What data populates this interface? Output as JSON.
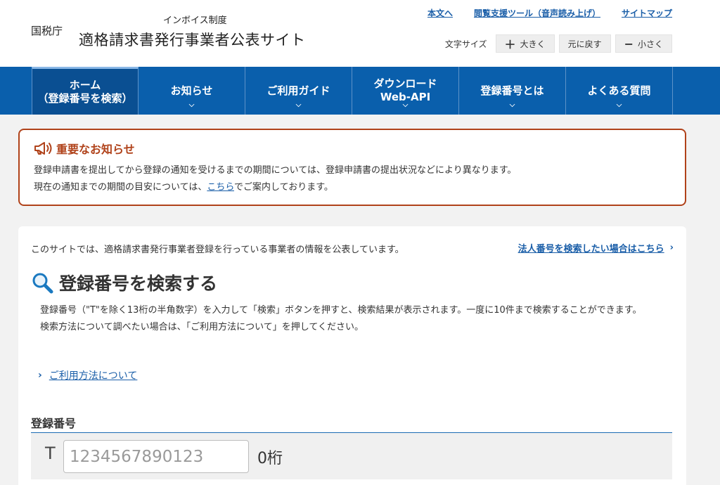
{
  "header": {
    "agency": "国税庁",
    "subtitle": "インボイス制度",
    "title": "適格請求書発行事業者公表サイト",
    "links": [
      "本文へ",
      "閲覧支援ツール（音声読み上げ）",
      "サイトマップ"
    ],
    "font_size": {
      "label": "文字サイズ",
      "larger": "大きく",
      "reset": "元に戻す",
      "smaller": "小さく"
    }
  },
  "nav": {
    "items": [
      {
        "line1": "ホーム",
        "line2": "（登録番号を検索）",
        "active": true
      },
      {
        "line1": "お知らせ",
        "line2": ""
      },
      {
        "line1": "ご利用ガイド",
        "line2": ""
      },
      {
        "line1": "ダウンロード",
        "line2": "Web-API"
      },
      {
        "line1": "登録番号とは",
        "line2": ""
      },
      {
        "line1": "よくある質問",
        "line2": ""
      }
    ]
  },
  "notice": {
    "title": "重要なお知らせ",
    "line1": "登録申請書を提出してから登録の通知を受けるまでの期間については、登録申請書の提出状況などにより異なります。",
    "line2_before": "現在の通知までの期間の目安については、",
    "line2_link": "こちら",
    "line2_after": "でご案内しております。"
  },
  "main": {
    "intro": "このサイトでは、適格請求書発行事業者登録を行っている事業者の情報を公表しています。",
    "corp_link": "法人番号を検索したい場合はこちら",
    "search_heading": "登録番号を検索する",
    "desc1": "登録番号（\"T\"を除く13桁の半角数字）を入力して「検索」ボタンを押すと、検索結果が表示されます。一度に10件まで検索することができます。",
    "desc2": "検索方法について調べたい場合は、「ご利用方法について」を押してください。",
    "guide_link": "ご利用方法について",
    "field_label": "登録番号",
    "t_prefix": "T",
    "input_placeholder": "1234567890123",
    "digit_count": "0桁"
  },
  "colors": {
    "nav_bg": "#0a5fac",
    "notice_border": "#b0421a",
    "link": "#1a5ea8"
  }
}
